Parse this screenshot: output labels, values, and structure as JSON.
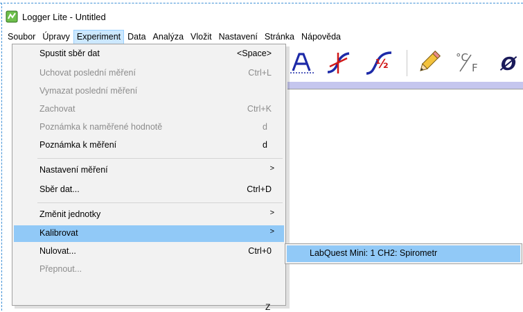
{
  "window": {
    "title": "Logger Lite - Untitled"
  },
  "menubar": [
    {
      "label": "Soubor",
      "active": false
    },
    {
      "label": "Úpravy",
      "active": false
    },
    {
      "label": "Experiment",
      "active": true
    },
    {
      "label": "Data",
      "active": false
    },
    {
      "label": "Analýza",
      "active": false
    },
    {
      "label": "Vložit",
      "active": false
    },
    {
      "label": "Nastavení",
      "active": false
    },
    {
      "label": "Stránka",
      "active": false
    },
    {
      "label": "Nápověda",
      "active": false
    }
  ],
  "toolbar": {
    "icons": [
      "text-annotation-icon",
      "tangent-icon",
      "integral-icon",
      "pencil-icon",
      "temperature-unit-icon",
      "zero-icon"
    ],
    "fraction_label": "½",
    "unit_c": "°C",
    "unit_f": "F",
    "zero_label": "Ø"
  },
  "experiment_menu": {
    "items": [
      {
        "label": "Spustit sběr dat",
        "shortcut": "<Space>",
        "disabled": false
      },
      {
        "label": "Uchovat poslední měření",
        "shortcut": "Ctrl+L",
        "disabled": true
      },
      {
        "label": "Vymazat poslední měření",
        "shortcut": "",
        "disabled": true
      },
      {
        "label": "Zachovat",
        "shortcut": "Ctrl+K",
        "disabled": true
      },
      {
        "label": "Poznámka k naměřené hodnotě",
        "shortcut": "d",
        "disabled": true
      },
      {
        "label": "Poznámka k měření",
        "shortcut": "d",
        "disabled": false
      },
      {
        "label": "Nastavení měření",
        "shortcut": "",
        "submenu": true,
        "disabled": false
      },
      {
        "label": "Sběr dat...",
        "shortcut": "Ctrl+D",
        "disabled": false
      },
      {
        "label": "Změnit jednotky",
        "shortcut": "",
        "submenu": true,
        "disabled": false
      },
      {
        "label": "Kalibrovat",
        "shortcut": "",
        "submenu": true,
        "disabled": false,
        "highlighted": true
      },
      {
        "label": "Nulovat...",
        "shortcut": "Ctrl+0",
        "disabled": false
      },
      {
        "label": "Přepnout...",
        "shortcut": "",
        "disabled": true
      }
    ]
  },
  "calibrate_submenu": {
    "items": [
      {
        "label": "LabQuest Mini: 1 CH2: Spirometr",
        "highlighted": true
      }
    ]
  },
  "partial_text": "Z",
  "colors": {
    "menu_bg": "#f2f2f2",
    "highlight": "#91c9f7",
    "menubar_active": "#cce8ff",
    "disabled_text": "#8c8c8c",
    "strip": "#c5c6ee"
  }
}
